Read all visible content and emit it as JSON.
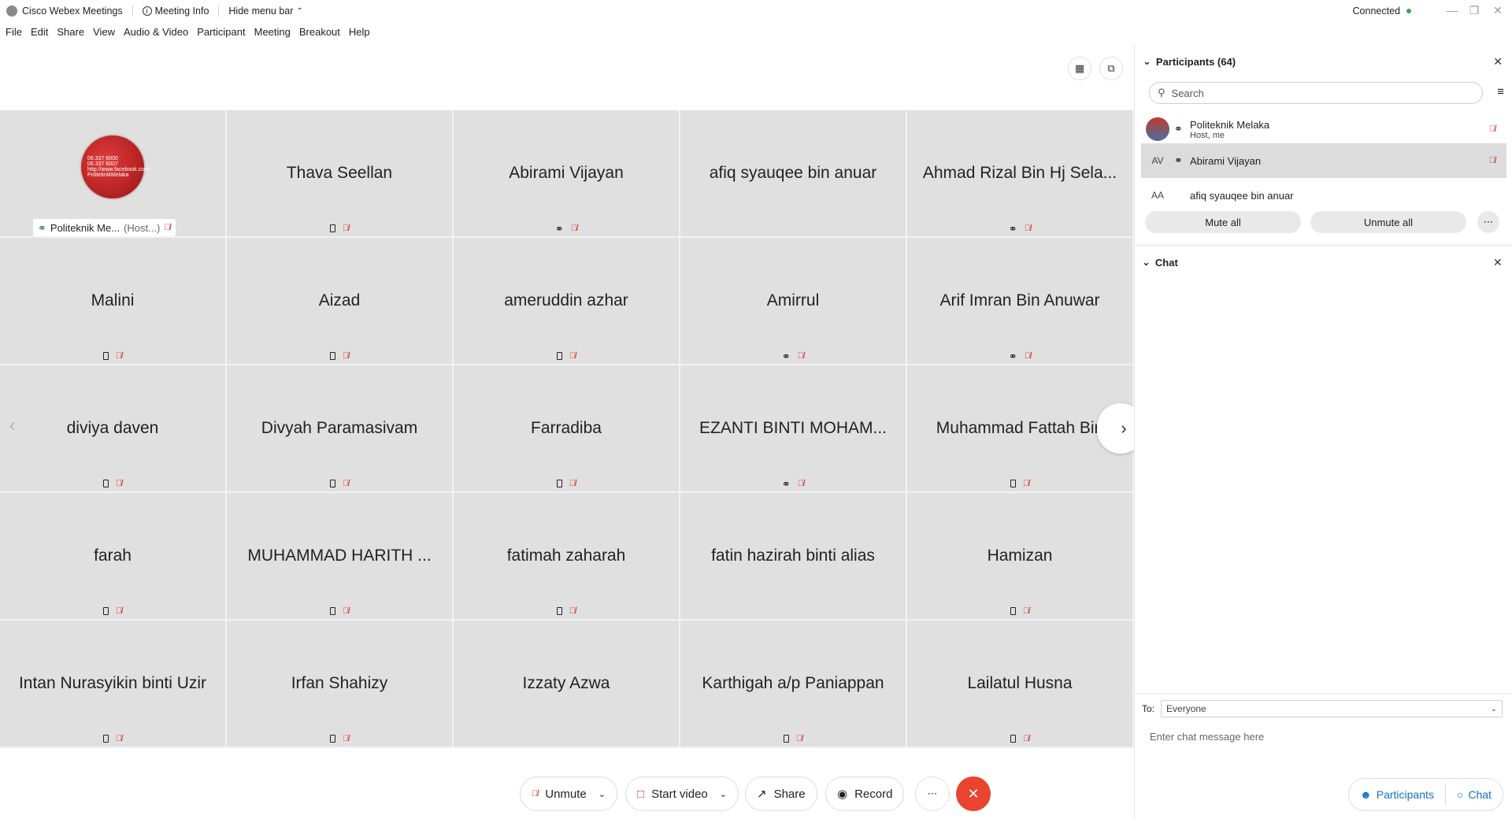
{
  "titlebar": {
    "app_name": "Cisco Webex Meetings",
    "meeting_info": "Meeting Info",
    "hide_menu": "Hide menu bar",
    "status": "Connected"
  },
  "menu": [
    "File",
    "Edit",
    "Share",
    "View",
    "Audio & Video",
    "Participant",
    "Meeting",
    "Breakout",
    "Help"
  ],
  "host_tile": {
    "avatar_lines": [
      "06.337 6000",
      "06.337 6007",
      "http://www.facebook.com",
      "PoliteknikMelaka"
    ],
    "label": "Politeknik Me...",
    "role": "(Host...)"
  },
  "tiles": [
    {
      "name": "Thava Seellan",
      "icons": [
        "device",
        "mute"
      ]
    },
    {
      "name": "Abirami Vijayan",
      "icons": [
        "headset",
        "mute"
      ]
    },
    {
      "name": "afiq syauqee bin anuar",
      "icons": []
    },
    {
      "name": "Ahmad Rizal Bin Hj Sela...",
      "icons": [
        "headset",
        "mute"
      ]
    },
    {
      "name": "Malini",
      "icons": [
        "device",
        "mute"
      ]
    },
    {
      "name": "Aizad",
      "icons": [
        "device",
        "mute"
      ]
    },
    {
      "name": "ameruddin azhar",
      "icons": [
        "device",
        "mute"
      ]
    },
    {
      "name": "Amirrul",
      "icons": [
        "headset",
        "mute"
      ]
    },
    {
      "name": "Arif Imran Bin Anuwar",
      "icons": [
        "headset",
        "mute"
      ]
    },
    {
      "name": "diviya daven",
      "icons": [
        "device",
        "mute"
      ]
    },
    {
      "name": "Divyah Paramasivam",
      "icons": [
        "device",
        "mute"
      ]
    },
    {
      "name": "Farradiba",
      "icons": [
        "device",
        "mute"
      ]
    },
    {
      "name": "EZANTI BINTI MOHAM...",
      "icons": [
        "headset",
        "mute"
      ]
    },
    {
      "name": "Muhammad Fattah Bin",
      "icons": [
        "device",
        "mute"
      ]
    },
    {
      "name": "farah",
      "icons": [
        "device",
        "mute"
      ]
    },
    {
      "name": "MUHAMMAD HARITH ...",
      "icons": [
        "device",
        "mute"
      ]
    },
    {
      "name": "fatimah zaharah",
      "icons": [
        "device",
        "mute"
      ]
    },
    {
      "name": "fatin hazirah binti alias",
      "icons": []
    },
    {
      "name": "Hamizan",
      "icons": [
        "device",
        "mute"
      ]
    },
    {
      "name": "Intan Nurasyikin binti Uzir",
      "icons": [
        "device",
        "mute"
      ]
    },
    {
      "name": "Irfan Shahizy",
      "icons": [
        "device",
        "mute"
      ]
    },
    {
      "name": "Izzaty Azwa",
      "icons": []
    },
    {
      "name": "Karthigah a/p Paniappan",
      "icons": [
        "device",
        "mute"
      ]
    },
    {
      "name": "Lailatul Husna",
      "icons": [
        "device",
        "mute"
      ]
    }
  ],
  "controls": {
    "unmute": "Unmute",
    "start_video": "Start video",
    "share": "Share",
    "record": "Record"
  },
  "participants_panel": {
    "title": "Participants (64)",
    "search_placeholder": "Search",
    "list": [
      {
        "name": "Politeknik Melaka",
        "sub": "Host, me",
        "initials": ""
      },
      {
        "name": "Abirami Vijayan",
        "sub": "",
        "initials": "AV"
      },
      {
        "name": "afiq syauqee bin anuar",
        "sub": "",
        "initials": "AA"
      }
    ],
    "mute_all": "Mute all",
    "unmute_all": "Unmute all"
  },
  "chat_panel": {
    "title": "Chat",
    "to_label": "To:",
    "to_value": "Everyone",
    "input_placeholder": "Enter chat message here"
  },
  "panel_toggles": {
    "participants": "Participants",
    "chat": "Chat"
  },
  "colors": {
    "tile_bg": "#e0e0e0",
    "mute_red": "#d93025",
    "end_call": "#e8442f",
    "accent_blue": "#1170cf",
    "status_green": "#2fa84f"
  }
}
